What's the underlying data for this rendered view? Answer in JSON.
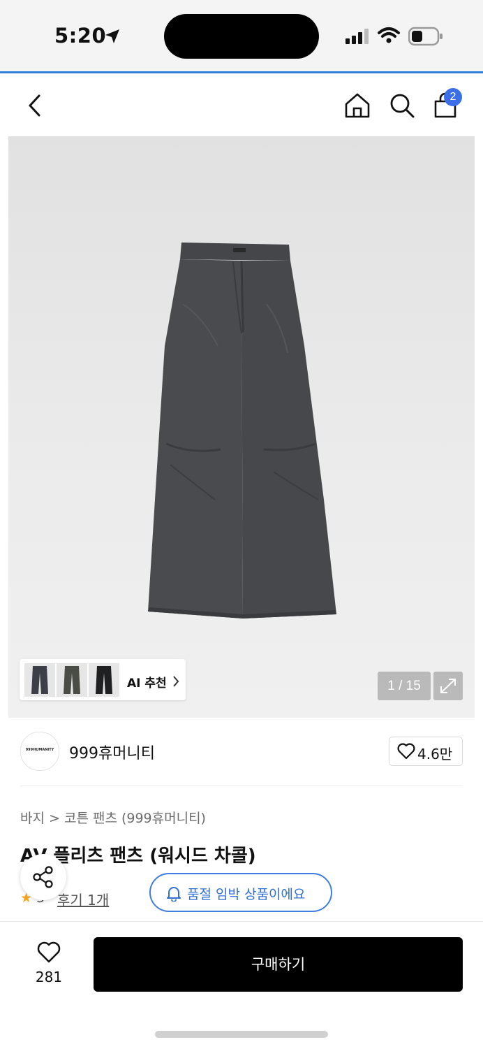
{
  "status_bar": {
    "time": "5:20"
  },
  "nav": {
    "cart_count": "2"
  },
  "gallery": {
    "ai_label": "AI 추천",
    "counter": "1 / 15"
  },
  "brand": {
    "logo_text": "999HUMANITY",
    "name": "999휴머니티",
    "favorite_count": "4.6만"
  },
  "product": {
    "breadcrumb": "바지 > 코튼 팬츠 (999휴머니티)",
    "title": "AV 플리츠 팬츠 (워시드 차콜)",
    "rating_digit": "5",
    "review_text": "후기 1개",
    "soldout_notice": "품절 임박 상품이에요"
  },
  "bottom_bar": {
    "like_count": "281",
    "buy_label": "구매하기"
  },
  "colors": {
    "accent_blue": "#3a6fe8",
    "status_line": "#2f7fd8",
    "buy_button": "#000000",
    "star": "#f5a623"
  }
}
